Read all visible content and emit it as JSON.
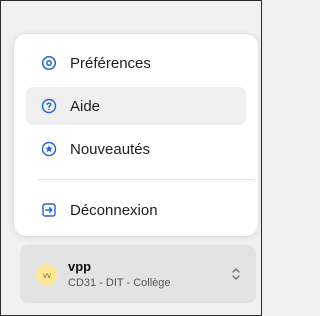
{
  "menu": {
    "items": [
      {
        "label": "Préférences",
        "icon": "gear-icon"
      },
      {
        "label": "Aide",
        "icon": "help-circle-icon"
      },
      {
        "label": "Nouveautés",
        "icon": "star-circle-icon"
      },
      {
        "label": "Déconnexion",
        "icon": "logout-icon"
      }
    ],
    "active_index": 1
  },
  "account": {
    "initials": "vv",
    "name": "vpp",
    "subtitle": "CD31 - DIT - Collège"
  },
  "colors": {
    "accent": "#1e63d6",
    "avatar_bg": "#fde79a",
    "active_bg": "#efefef"
  }
}
